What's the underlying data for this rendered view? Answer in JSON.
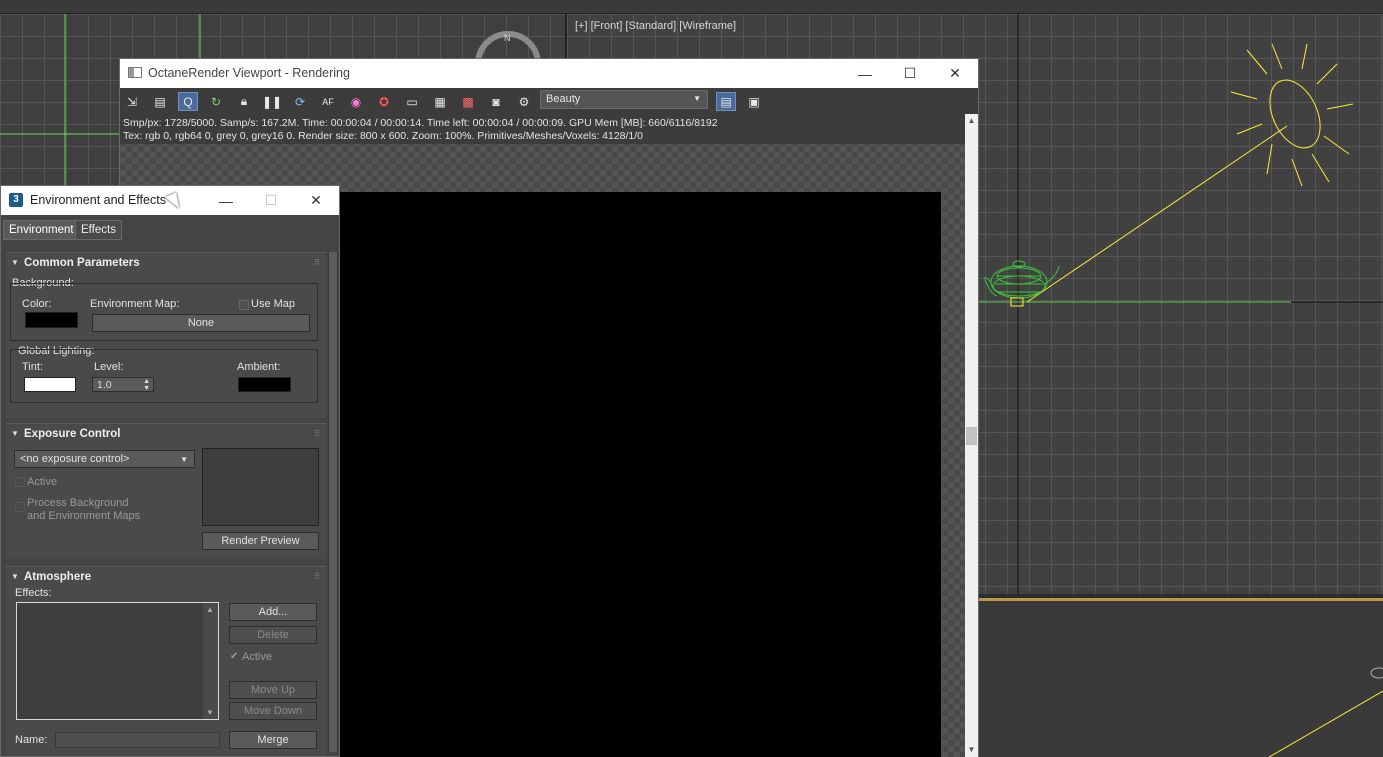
{
  "viewports": {
    "front_label": "[+] [Front] [Standard] [Wireframe]"
  },
  "octane": {
    "title": "OctaneRender Viewport - Rendering",
    "pass_select": "Beauty",
    "status_line1": "Smp/px: 1728/5000.   Samp/s: 167.2M.   Time: 00:00:04 / 00:00:14.   Time left: 00:00:04 / 00:00:09.   GPU Mem [MB]: 660/6116/8192",
    "status_line2": "Tex: rgb 0, rgb64 0, grey 0, grey16 0.   Render size: 800 x 600.   Zoom: 100%.   Primitives/Meshes/Voxels: 4128/1/0"
  },
  "env": {
    "title": "Environment and Effects",
    "tabs": [
      "Environment",
      "Effects"
    ],
    "common": {
      "title": "Common Parameters",
      "background_label": "Background:",
      "color_label": "Color:",
      "env_map_label": "Environment Map:",
      "use_map_label": "Use Map",
      "none_button": "None",
      "global_lighting_label": "Global Lighting:",
      "tint_label": "Tint:",
      "level_label": "Level:",
      "level_value": "1.0",
      "ambient_label": "Ambient:",
      "bg_color": "#000000",
      "tint_color": "#ffffff",
      "ambient_color": "#000000"
    },
    "exposure": {
      "title": "Exposure Control",
      "select_value": "<no exposure control>",
      "active_label": "Active",
      "process_label_1": "Process Background",
      "process_label_2": "and Environment Maps",
      "render_preview": "Render Preview"
    },
    "atmosphere": {
      "title": "Atmosphere",
      "effects_label": "Effects:",
      "add": "Add...",
      "delete": "Delete",
      "active_label": "Active",
      "move_up": "Move Up",
      "move_down": "Move Down",
      "name_label": "Name:",
      "merge": "Merge"
    }
  },
  "icons": {
    "minimize": "minimize-icon",
    "maximize": "maximize-icon",
    "close": "close-icon"
  }
}
